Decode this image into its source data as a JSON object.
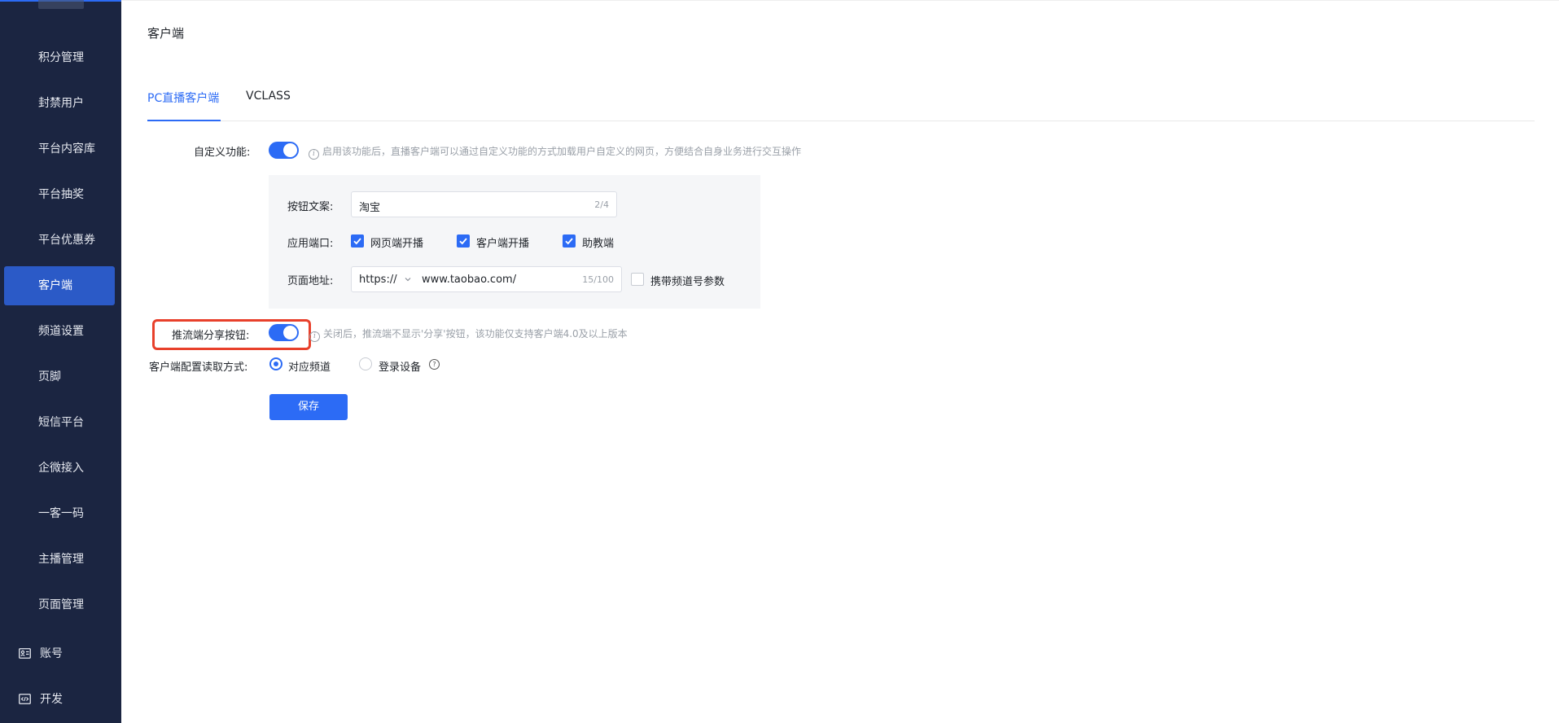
{
  "sidebar": {
    "items": [
      {
        "label": "",
        "partial": true
      },
      {
        "label": "积分管理"
      },
      {
        "label": "封禁用户"
      },
      {
        "label": "平台内容库"
      },
      {
        "label": "平台抽奖"
      },
      {
        "label": "平台优惠券"
      },
      {
        "label": "客户端",
        "active": true
      },
      {
        "label": "频道设置"
      },
      {
        "label": "页脚"
      },
      {
        "label": "短信平台"
      },
      {
        "label": "企微接入"
      },
      {
        "label": "一客一码"
      },
      {
        "label": "主播管理"
      },
      {
        "label": "页面管理"
      }
    ],
    "bottom": [
      {
        "label": "账号",
        "icon": "id-card-icon"
      },
      {
        "label": "开发",
        "icon": "code-icon"
      }
    ],
    "accent": "#2b5ac7",
    "background": "#1b2541"
  },
  "page": {
    "title": "客户端"
  },
  "tabs": [
    {
      "label": "PC直播客户端",
      "active": true
    },
    {
      "label": "VCLASS"
    }
  ],
  "form": {
    "custom_feature": {
      "label": "自定义功能:",
      "enabled": true,
      "hint": "启用该功能后，直播客户端可以通过自定义功能的方式加载用户自定义的网页，方便结合自身业务进行交互操作"
    },
    "button_text": {
      "label": "按钮文案:",
      "value": "淘宝",
      "count": "2/4"
    },
    "ports": {
      "label": "应用端口:",
      "options": [
        {
          "label": "网页端开播",
          "checked": true
        },
        {
          "label": "客户端开播",
          "checked": true
        },
        {
          "label": "助教端",
          "checked": true
        }
      ]
    },
    "page_url": {
      "label": "页面地址:",
      "protocol": "https://",
      "value": "www.taobao.com/",
      "count": "15/100",
      "carry_param": {
        "label": "携带频道号参数",
        "checked": false
      }
    },
    "share_button": {
      "label": "推流端分享按钮:",
      "enabled": true,
      "hint": "关闭后，推流端不显示'分享'按钮，该功能仅支持客户端4.0及以上版本"
    },
    "read_mode": {
      "label": "客户端配置读取方式:",
      "options": [
        {
          "label": "对应频道",
          "selected": true
        },
        {
          "label": "登录设备",
          "selected": false
        }
      ]
    },
    "save_label": "保存"
  },
  "colors": {
    "primary": "#2c6bf5",
    "highlight_border": "#e8402b"
  }
}
